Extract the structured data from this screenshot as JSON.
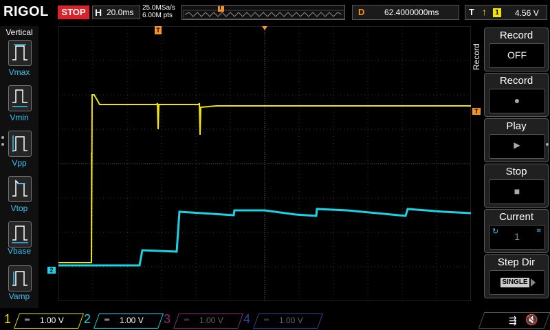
{
  "header": {
    "brand": "RIGOL",
    "run_state": "STOP",
    "horizontal_key": "H",
    "timebase": "20.0ms",
    "sample_rate": "25.0MSa/s",
    "memory_depth": "6.00M pts",
    "trigger_marker": "T",
    "delay_key": "D",
    "delay_value": "62.4000000ms",
    "trigger_key": "T",
    "trigger_source": "1",
    "trigger_level": "4.56 V"
  },
  "measure_panel": {
    "title": "Vertical",
    "items": [
      {
        "label": "Vmax",
        "icon": "vmax-icon"
      },
      {
        "label": "Vmin",
        "icon": "vmin-icon"
      },
      {
        "label": "Vpp",
        "icon": "vpp-icon"
      },
      {
        "label": "Vtop",
        "icon": "vtop-icon"
      },
      {
        "label": "Vbase",
        "icon": "vbase-icon"
      },
      {
        "label": "Vamp",
        "icon": "vamp-icon"
      }
    ]
  },
  "screen": {
    "ch2_marker": "2",
    "trig_level_marker": "T",
    "trig_pos_marker": "T",
    "colors": {
      "ch1": "#f2e500",
      "ch2": "#19d3e6",
      "grid": "#3a3a3a",
      "trigger": "#f7941d"
    }
  },
  "record_menu": {
    "side_label": "Record",
    "buttons": [
      {
        "title": "Record",
        "value": "OFF"
      },
      {
        "title": "Record",
        "value": "●"
      },
      {
        "title": "Play",
        "value": "▶"
      },
      {
        "title": "Stop",
        "value": "■"
      },
      {
        "title": "Current",
        "value": "1"
      },
      {
        "title": "Step Dir",
        "value": "SINGLE"
      }
    ]
  },
  "channels": [
    {
      "num": "1",
      "scale": "1.00 V",
      "color": "#f2e500"
    },
    {
      "num": "2",
      "scale": "1.00 V",
      "color": "#19d3e6"
    },
    {
      "num": "3",
      "scale": "1.00 V",
      "color": "#8a2c7c"
    },
    {
      "num": "4",
      "scale": "1.00 V",
      "color": "#2b4a9c"
    }
  ],
  "status": {
    "usb": "usb-icon",
    "sound": "speaker-muted-icon"
  }
}
